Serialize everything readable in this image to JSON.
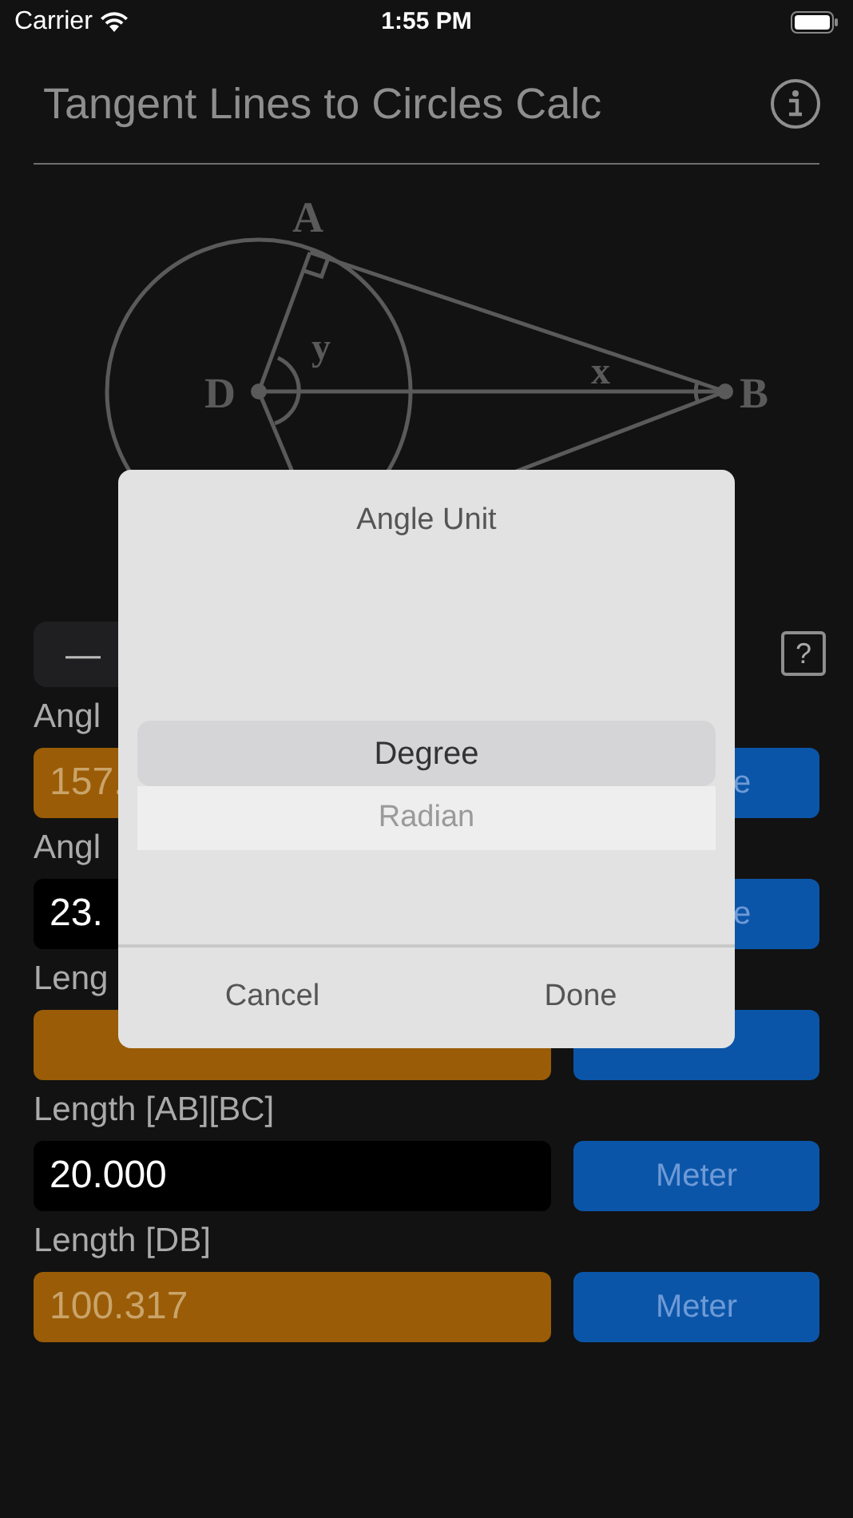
{
  "status_bar": {
    "carrier": "Carrier",
    "time": "1:55 PM"
  },
  "title": "Tangent Lines to Circles Calc",
  "diagram": {
    "labels": [
      "A",
      "y",
      "D",
      "x",
      "B"
    ]
  },
  "segmented": {
    "first": "—"
  },
  "help": "?",
  "rows": [
    {
      "label": "Angl",
      "value": "157.",
      "computed": true,
      "unit": "e"
    },
    {
      "label": "Angl",
      "value": "23.",
      "computed": false,
      "unit": "e"
    },
    {
      "label": "Leng",
      "computed": true
    },
    {
      "label": "Length [AB][BC]",
      "value": "20.000",
      "computed": false,
      "unit": "Meter"
    },
    {
      "label": "Length [DB]",
      "value": "100.317",
      "computed": true,
      "unit": "Meter"
    }
  ],
  "dialog": {
    "title": "Angle Unit",
    "options": [
      {
        "label": "Degree",
        "selected": true
      },
      {
        "label": "Radian",
        "selected": false
      }
    ],
    "buttons": [
      "Cancel",
      "Done"
    ]
  }
}
